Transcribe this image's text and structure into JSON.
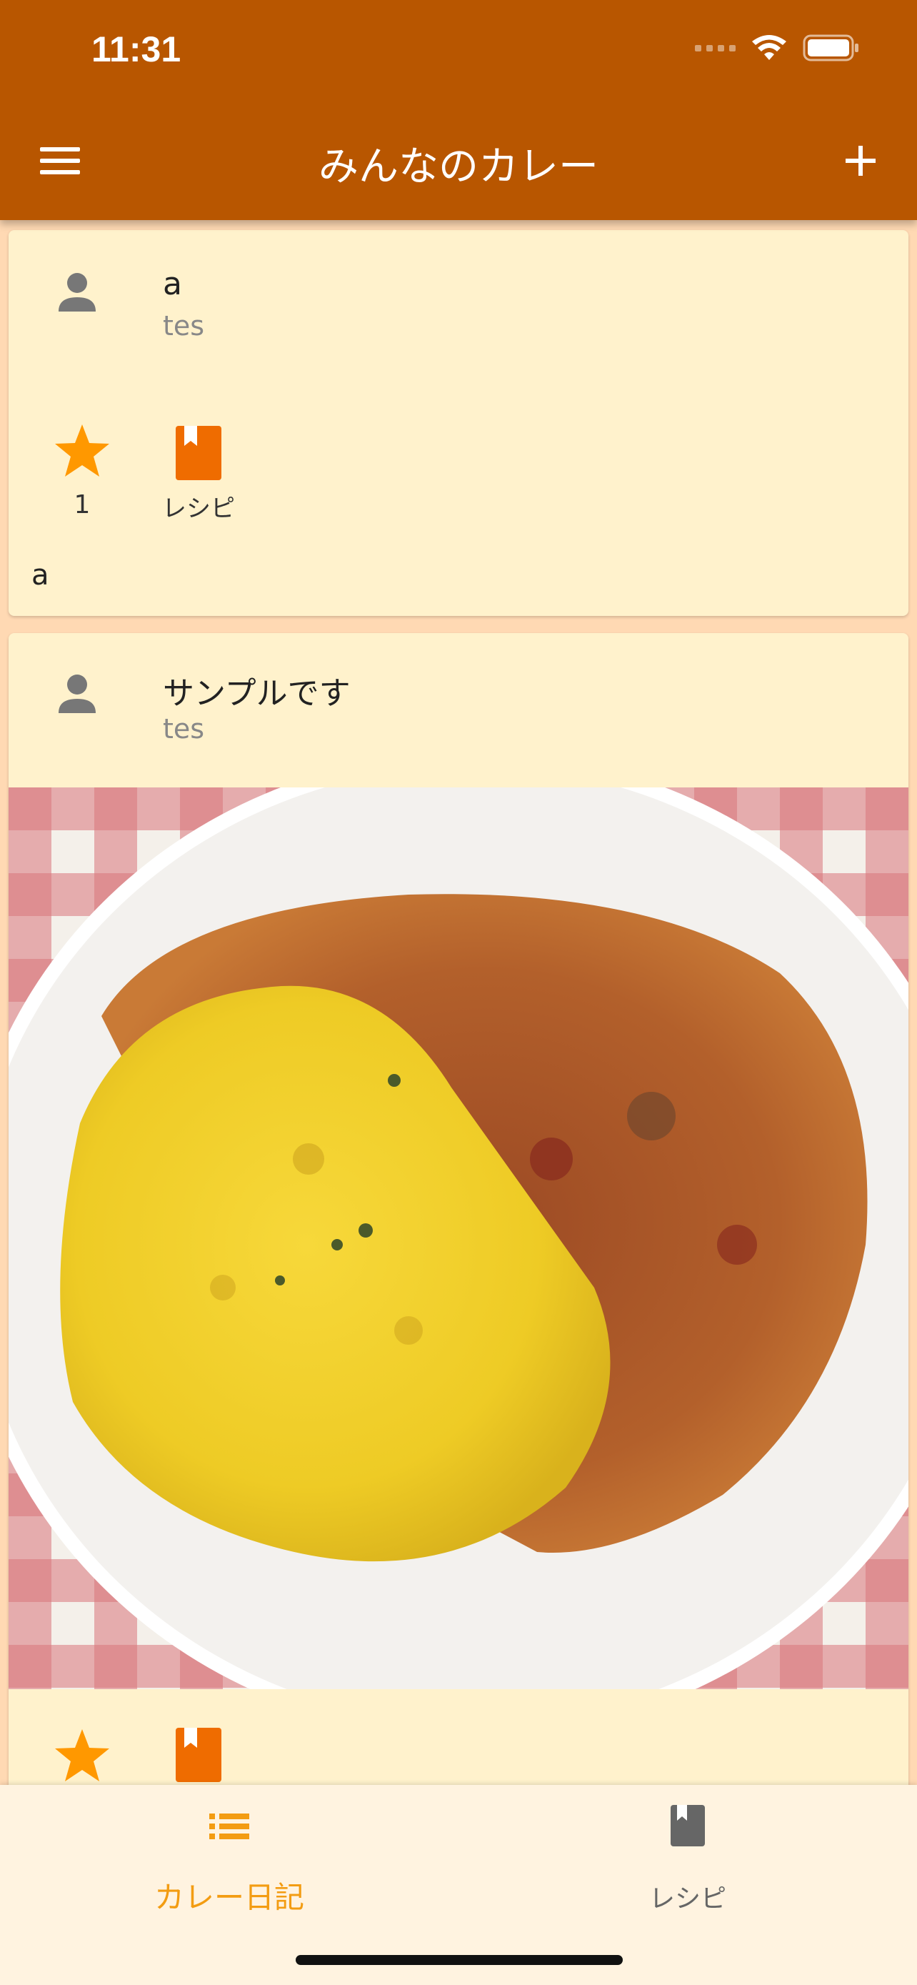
{
  "status_bar": {
    "time": "11:31"
  },
  "app_bar": {
    "title": "みんなのカレー"
  },
  "posts": [
    {
      "title": "a",
      "author": "tes",
      "like_count": "1",
      "recipe_label": "レシピ",
      "comment": "a",
      "has_photo": false
    },
    {
      "title": "サンプルです",
      "author": "tes",
      "has_photo": true,
      "photo_desc": "curry-with-turmeric-rice"
    }
  ],
  "bottom_nav": {
    "items": [
      {
        "label": "カレー日記",
        "icon": "list-icon",
        "active": true
      },
      {
        "label": "レシピ",
        "icon": "book-icon",
        "active": false
      }
    ]
  },
  "colors": {
    "app_bar": "#b85600",
    "background": "#ffd9b3",
    "card": "#fff2cc",
    "accent": "#f39c12",
    "bookmark": "#ef6c00"
  }
}
